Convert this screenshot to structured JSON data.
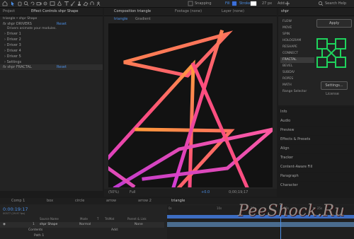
{
  "toolbar": {
    "snapping": "Snapping",
    "fill_label": "Fill",
    "stroke_label": "Stroke",
    "stroke_width": "27 px",
    "add_label": "Add:",
    "search": "Search Help",
    "tool_icons": [
      "home-icon",
      "selection-icon",
      "hand-icon",
      "zoom-icon",
      "rotate-icon",
      "camera-icon",
      "pan-behind-icon",
      "rectangle-icon",
      "pen-icon",
      "type-icon",
      "brush-icon",
      "clone-stamp-icon",
      "eraser-icon",
      "roto-icon",
      "puppet-icon"
    ]
  },
  "left_panel": {
    "tabs": [
      "Project",
      "Effect Controls shpr Shape"
    ],
    "title": "triangle • shpr Shape",
    "drivers_fx": "shpr DRIVERS",
    "reset": "Reset",
    "note": "Drivers animate your modules.",
    "drivers": [
      "Driver 1",
      "Driver 2",
      "Driver 3",
      "Driver 4",
      "Driver 5"
    ],
    "settings": "Settings",
    "fractal_fx": "shpr FRACTAL",
    "reset2": "Reset"
  },
  "composition": {
    "tabs": [
      "Composition triangle",
      "Footage (none)",
      "Layer (none)"
    ],
    "subtabs": [
      "triangle",
      "Gradient"
    ],
    "footer": {
      "zoom": "(50%)",
      "quality": "Full",
      "plus": "+0.0",
      "time": "0;00;19;17"
    }
  },
  "shpr_panel": {
    "title": "shpr",
    "modules": [
      "FLOW",
      "MOVE",
      "SPIN",
      "HOLOGRAM",
      "RESHAPE",
      "CONNECT",
      "FRACTAL",
      "BEVEL",
      "SUBDIV",
      "ROPES",
      "MATH",
      "Range Selector"
    ],
    "selected": "FRACTAL",
    "apply": "Apply",
    "settings": "Settings...",
    "license": "License",
    "accent": "#1fd35d"
  },
  "right_panels": [
    "Info",
    "Audio",
    "Preview",
    "Effects & Presets",
    "Align",
    "Tracker",
    "Content-Aware Fill",
    "Paragraph",
    "Character"
  ],
  "timeline": {
    "tabs": [
      "Comp 1",
      "box",
      "circle",
      "arrow",
      "arrow 2",
      "triangle"
    ],
    "time": "0:00:19:17",
    "fps": "00577 (29.97 fps)",
    "columns": [
      "Source Name",
      "Mode",
      "T",
      "TrkMat",
      "Parent & Link"
    ],
    "layer": {
      "num": "1",
      "name": "Shape Layer",
      "fx_name": "shpr Shape",
      "mode": "Normal",
      "parent": "None"
    },
    "contents": "Contents",
    "add": "Add:",
    "path": "Path 1",
    "ruler": [
      "0s",
      "10s",
      "15s",
      "20s",
      "25s"
    ]
  },
  "watermark": "PeeShock.Ru",
  "colors": {
    "accent_blue": "#4b8fe6",
    "playhead": "#4b8fe6"
  }
}
